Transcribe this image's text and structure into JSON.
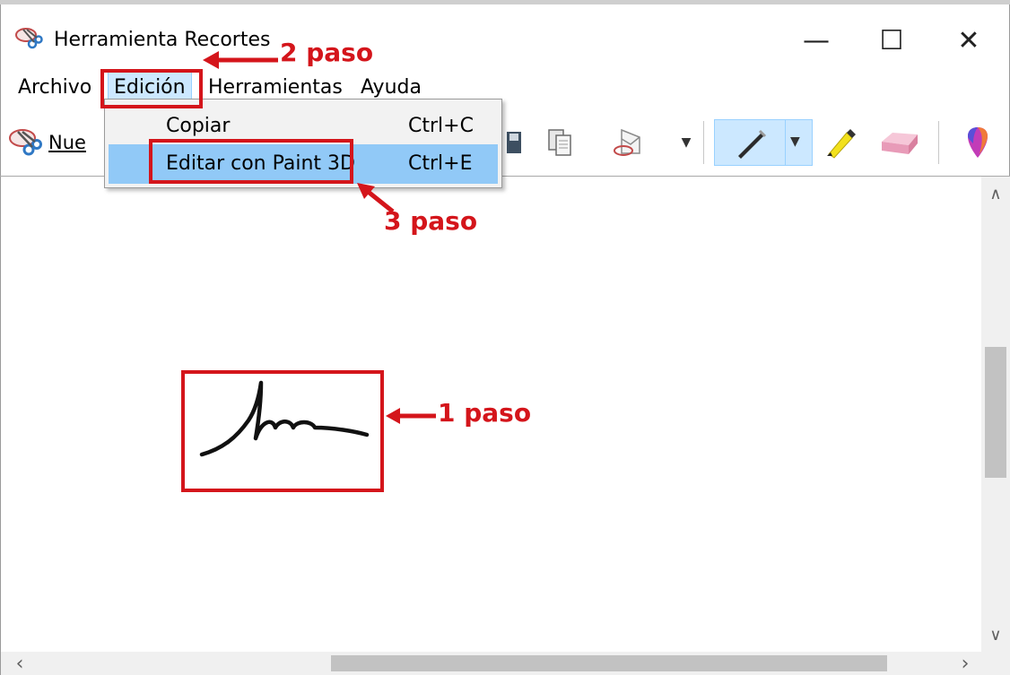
{
  "window": {
    "title": "Herramienta Recortes",
    "controls": {
      "minimize": "—",
      "maximize": "☐",
      "close": "✕"
    }
  },
  "menubar": {
    "items": [
      "Archivo",
      "Edición",
      "Herramientas",
      "Ayuda"
    ],
    "active": "Edición"
  },
  "toolbar": {
    "new_label": "Nue",
    "icons": [
      "snipping-tool-icon",
      "save-icon",
      "copy-icon",
      "send-icon",
      "dropdown-icon",
      "pen-icon",
      "highlighter-icon",
      "eraser-icon",
      "paint3d-icon"
    ]
  },
  "dropdown": {
    "items": [
      {
        "label": "Copiar",
        "shortcut": "Ctrl+C"
      },
      {
        "label": "Editar con Paint 3D",
        "shortcut": "Ctrl+E",
        "highlighted": true
      }
    ]
  },
  "annotations": {
    "step1": "1 paso",
    "step2": "2 paso",
    "step3": "3 paso",
    "color": "#d4151b"
  },
  "colors": {
    "menu_highlight": "#cce8ff",
    "dropdown_selected": "#91c9f7",
    "annotation_red": "#d4151b"
  }
}
